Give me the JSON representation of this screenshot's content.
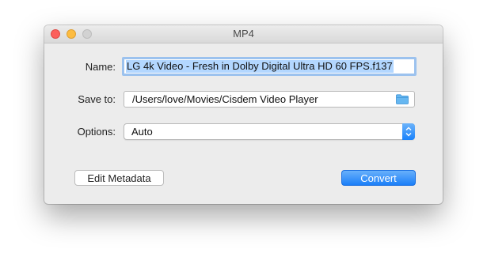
{
  "window": {
    "title": "MP4",
    "controls": [
      "close",
      "minimize",
      "zoom"
    ]
  },
  "form": {
    "name_label": "Name:",
    "name_value": "LG 4k Video - Fresh in Dolby Digital Ultra HD 60 FPS.f137",
    "save_label": "Save to:",
    "save_path": "/Users/love/Movies/Cisdem Video Player",
    "save_icon": "folder-icon",
    "options_label": "Options:",
    "options_value": "Auto"
  },
  "buttons": {
    "edit_metadata": "Edit Metadata",
    "convert": "Convert"
  },
  "colors": {
    "accent": "#1b7ff8",
    "selection": "#b3d7ff",
    "close": "#fc605c",
    "minimize": "#fdbc40"
  }
}
